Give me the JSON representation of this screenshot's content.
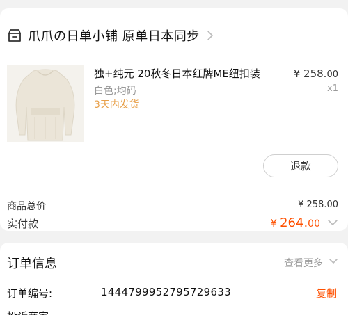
{
  "shop": {
    "name": "爪爪の日单小铺 原单日本同步"
  },
  "product": {
    "title": "独+纯元 20秋冬日本红牌ME纽扣装",
    "price_main": "¥ 258.",
    "price_dec": "00",
    "spec": "白色;均码",
    "qty": "x1",
    "shipping": "3天内发货"
  },
  "actions": {
    "refund_label": "退款"
  },
  "summary": {
    "goods_total_label": "商品总价",
    "goods_total_value": "¥ 258.00",
    "paid_label": "实付款",
    "paid_currency": "¥",
    "paid_main": "264.",
    "paid_dec": "00"
  },
  "order_info": {
    "title": "订单信息",
    "more_label": "查看更多",
    "order_no_label": "订单编号:",
    "order_no_value": "1444799952795729633",
    "copy_label": "复制",
    "next_row_label": "投诉商家"
  },
  "colors": {
    "accent": "#ff5000",
    "shipping": "#e8a04a",
    "muted": "#999999"
  },
  "icons": {
    "shop": "shop-icon",
    "chevron_right": "chevron-right-icon",
    "chevron_down": "chevron-down-icon"
  }
}
